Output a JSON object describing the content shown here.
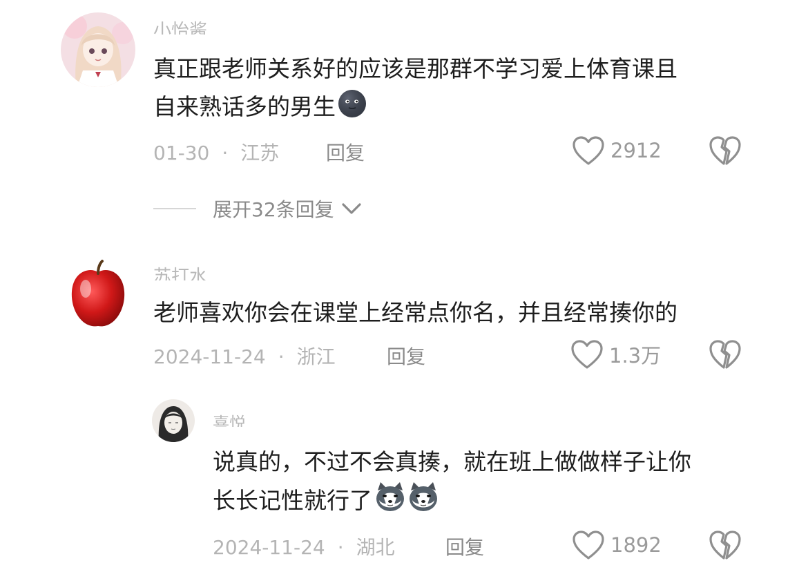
{
  "comments": [
    {
      "username": "小怡酱",
      "text_line1": "真正跟老师关系好的应该是那群不学习爱上体育课且",
      "text_line2": "自来熟话多的男生",
      "emoji": "new-moon-face-emoji",
      "date": "01-30",
      "location": "江苏",
      "reply_label": "回复",
      "likes": "2912",
      "avatar": "anime-girl-avatar"
    },
    {
      "username": "苏打水",
      "text_line1": "老师喜欢你会在课堂上经常点你名，并且经常揍你的",
      "date": "2024-11-24",
      "location": "浙江",
      "reply_label": "回复",
      "likes": "1.3万",
      "avatar": "red-apple-avatar"
    }
  ],
  "expand_replies": {
    "label": "展开32条回复"
  },
  "reply": {
    "username": "喜悦.",
    "text_line1": "说真的，不过不会真揍，就在班上做做样子让你",
    "text_line2": "长长记性就行了",
    "emoji": "doge-husky-emoji",
    "date": "2024-11-24",
    "location": "湖北",
    "reply_label": "回复",
    "likes": "1892",
    "avatar": "sketch-person-avatar"
  },
  "icons": {
    "like": "heart-outline-icon",
    "dislike": "broken-heart-icon",
    "expand": "chevron-down-icon"
  },
  "colors": {
    "text": "#1e1e1e",
    "meta": "#b4b4b4",
    "icon": "#8f8f8f"
  }
}
